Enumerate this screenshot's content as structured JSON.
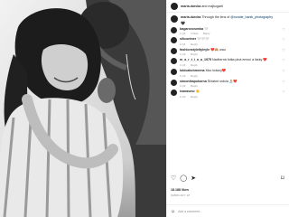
{
  "header": {
    "username": "maria.durcka",
    "extra": "and majkogarti"
  },
  "caption": {
    "username": "maria.durcka",
    "text_before": "Through the lens of",
    "mention": "@rozalie_hanik_photography",
    "heart": "🖤"
  },
  "comments": [
    {
      "username": "bagarovcsenka",
      "text": "🤍",
      "time": "1 týž.",
      "likes": "2 likes",
      "reply": "Reply"
    },
    {
      "username": "silicontner",
      "text": "🤍🤍🤍",
      "time": "1 týž.",
      "likes": "",
      "reply": "Reply"
    },
    {
      "username": "fashionstyleityleyle",
      "text": "❤️🙈 wau",
      "time": "1 týž.",
      "likes": "",
      "reply": "Reply"
    },
    {
      "username": "m_a_r_t_i_n_a_1975",
      "text": "Nadherná fotka plná emocí a lásky ❤️",
      "time": "1 týž.",
      "likes": "",
      "reply": "Reply"
    },
    {
      "username": "lubicakohmerna",
      "text": "Moc krásný❤️",
      "time": "1 týž.",
      "likes": "",
      "reply": "Reply"
    },
    {
      "username": "simonikapokorna",
      "text": "Šťastné srdcia 🏝️❤️",
      "time": "1 týž.",
      "likes": "",
      "reply": "Reply"
    },
    {
      "username": "ivanavmo",
      "text": "👏",
      "time": "1 týž.",
      "likes": "",
      "reply": "Reply"
    }
  ],
  "actions": {
    "like_icon": "♡",
    "comment_icon": "◯",
    "share_icon": "➤",
    "save_icon": "⌑"
  },
  "likes_text": "18.188 likes",
  "date_text": "FEBRUARY 28",
  "add_comment": {
    "emoji_icon": "☺",
    "placeholder": "Add a comment..."
  }
}
